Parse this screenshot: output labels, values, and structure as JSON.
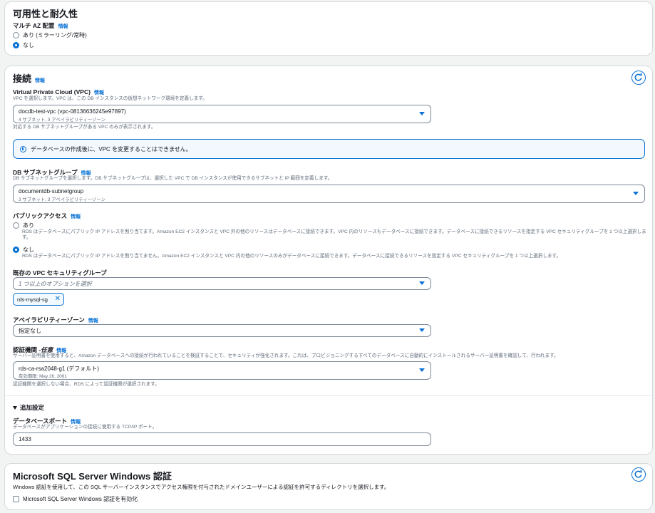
{
  "availability": {
    "title": "可用性と耐久性",
    "multi_az_label": "マルチ AZ 配置",
    "info": "情報",
    "options": [
      {
        "label": "あり (ミラーリング/常時)",
        "selected": false
      },
      {
        "label": "なし",
        "selected": true
      }
    ]
  },
  "connectivity": {
    "title": "接続",
    "info": "情報",
    "vpc": {
      "label": "Virtual Private Cloud (VPC)",
      "info": "情報",
      "description": "VPC を選択します。VPC は、この DB インスタンスの仮想ネットワーク環境を定義します。",
      "value": "docdb-test-vpc (vpc-08136636245e97897)",
      "sub": "4 サブネット, 3 アベイラビリティーゾーン",
      "hint": "対応する DB サブネットグループがある VPC のみが表示されます。"
    },
    "alert": "データベースの作成後に、VPC を変更することはできません。",
    "subnet_group": {
      "label": "DB サブネットグループ",
      "info": "情報",
      "description": "DB サブネットグループを選択します。DB サブネットグループは、選択した VPC で DB インスタンスが使用できるサブネットと IP 範囲を定義します。",
      "value": "documentdb-subnetgroup",
      "sub": "3 サブネット, 3 アベイラビリティーゾーン"
    },
    "public_access": {
      "label": "パブリックアクセス",
      "info": "情報",
      "options": [
        {
          "label": "あり",
          "selected": false,
          "description": "RDS はデータベースにパブリック IP アドレスを割り当てます。Amazon EC2 インスタンスと VPC 外の他のリソースはデータベースに接続できます。VPC 内のリソースもデータベースに接続できます。データベースに接続できるリソースを指定する VPC セキュリティグループを 1 つ以上選択します。"
        },
        {
          "label": "なし",
          "selected": true,
          "description": "RDS はデータベースにパブリック IP アドレスを割り当てません。Amazon EC2 インスタンスと VPC 内の他のリソースのみがデータベースに接続できます。データベースに接続できるリソースを指定する VPC セキュリティグループを 1 つ以上選択します。"
        }
      ]
    },
    "security_group": {
      "label": "既存の VPC セキュリティグループ",
      "placeholder": "1 つ以上のオプションを選択",
      "token": "rds-mysql-sg"
    },
    "az": {
      "label": "アベイラビリティーゾーン",
      "info": "情報",
      "value": "指定なし"
    },
    "ca": {
      "label": "認証機関 - ",
      "label_optional": "任意",
      "info": "情報",
      "description": "サーバー証明書を使用すると、Amazon データベースへの接続が行われていることを検証することで、セキュリティが強化されます。これは、プロビジョニングするすべてのデータベースに自動的にインストールされるサーバー証明書を確認して、行われます。",
      "value": "rds-ca-rsa2048-g1 (デフォルト)",
      "sub": "有効期限: May 26, 2061",
      "hint": "認証機関を選択しない場合、RDS によって認証機関が選択されます。"
    },
    "additional": {
      "title": "追加設定",
      "port_label": "データベースポート",
      "info": "情報",
      "port_description": "データベースがアプリケーションの接続に使用する TCP/IP ポート。",
      "port_value": "1433"
    }
  },
  "windows_auth": {
    "title": "Microsoft SQL Server Windows 認証",
    "description": "Windows 認証を使用して、この SQL サーバーインスタンスでアクセス権限を付与されたドメインユーザーによる認証を許可するディレクトリを選択します。",
    "checkbox_label": "Microsoft SQL Server Windows 認証を有効化"
  },
  "colors": {
    "accent": "#0972d3",
    "border": "#7d8998",
    "muted": "#5f6b7a"
  },
  "icons": [
    "refresh-icon",
    "info-circle-icon",
    "caret-down-icon",
    "close-icon",
    "triangle-down-icon"
  ]
}
